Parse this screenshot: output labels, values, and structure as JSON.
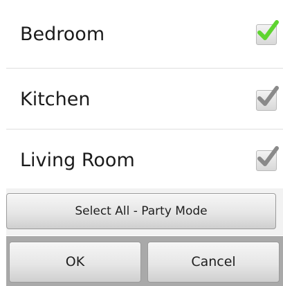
{
  "rooms": [
    {
      "label": "Bedroom",
      "checked": true,
      "check_color": "#5fd431"
    },
    {
      "label": "Kitchen",
      "checked": true,
      "check_color": "#8a8a8a"
    },
    {
      "label": "Living Room",
      "checked": true,
      "check_color": "#8a8a8a"
    }
  ],
  "select_all_label": "Select All - Party Mode",
  "buttons": {
    "ok_label": "OK",
    "cancel_label": "Cancel"
  }
}
